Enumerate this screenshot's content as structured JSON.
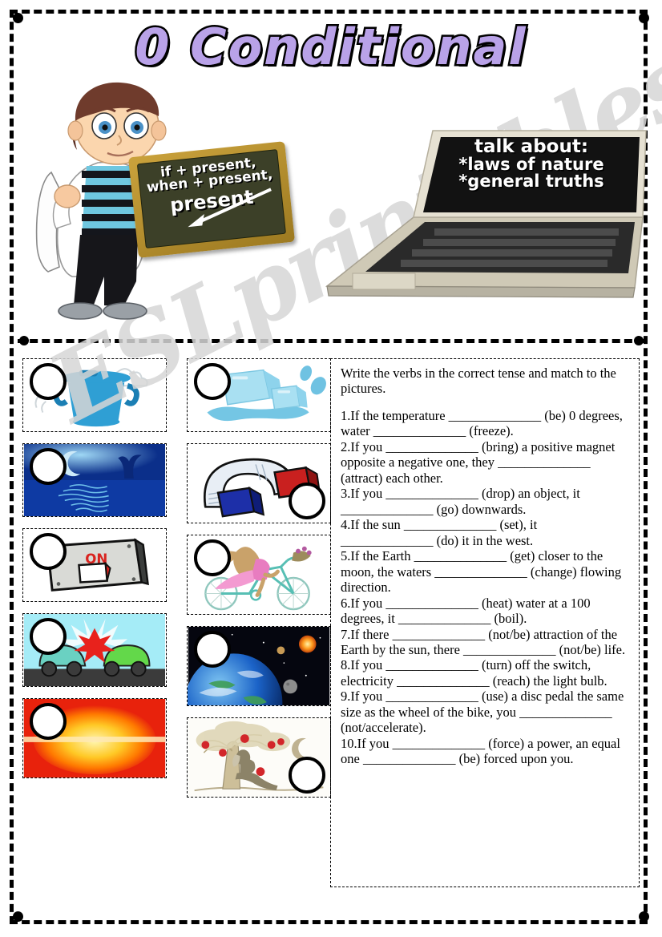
{
  "page": {
    "title": "0 Conditional",
    "watermark": "ESLprintables.com"
  },
  "header": {
    "chalkboard": {
      "line1": "if + present,",
      "line2": "when + present,",
      "line3": "present"
    },
    "laptop_screen": {
      "line1": "talk about:",
      "line2": "*laws of nature",
      "line3": "*general truths"
    }
  },
  "exercise": {
    "instruction": "Write the verbs in the correct tense and match to the pictures.",
    "items": [
      "1.If the temperature ______________ (be) 0 degrees, water ______________ (freeze).",
      "2.If you ______________ (bring) a positive magnet opposite a negative one, they ______________ (attract) each other.",
      "3.If you ______________ (drop) an object, it ______________ (go) downwards.",
      "4.If the sun ______________ (set), it ______________ (do) it in the west.",
      "5.If the Earth ______________ (get) closer to the moon, the waters ______________ (change) flowing direction.",
      "6.If you ______________ (heat) water at a 100 degrees, it ______________ (boil).",
      "7.If there ______________ (not/be) attraction of the Earth by the sun, there ______________ (not/be) life.",
      "8.If you ______________ (turn) off the switch, electricity ______________ (reach) the light bulb.",
      "9.If you ______________ (use) a disc pedal the same size as the wheel of the bike, you ______________ (not/accelerate).",
      "10.If you ______________ (force) a power, an equal one ______________ (be) forced upon you."
    ]
  },
  "pictures": {
    "column1": [
      {
        "id": "boiling-pot",
        "label": "boiling pot with steam",
        "circle": "top-left"
      },
      {
        "id": "moonlit-sea",
        "label": "moonlit sea at night",
        "circle": "top-left"
      },
      {
        "id": "light-switch",
        "label": "light switch marked ON",
        "circle": "top-left",
        "switch_text": "ON"
      },
      {
        "id": "car-crash",
        "label": "two cars colliding",
        "circle": "top-left"
      },
      {
        "id": "sunset",
        "label": "sun setting",
        "circle": "top-left"
      }
    ],
    "column2": [
      {
        "id": "melting-ice",
        "label": "melting ice cubes",
        "circle": "top-left"
      },
      {
        "id": "magnet",
        "label": "horseshoe magnet with red and blue poles",
        "circle": "bottom-right"
      },
      {
        "id": "woman-bicycle",
        "label": "woman riding a bicycle",
        "circle": "top-left"
      },
      {
        "id": "earth-space",
        "label": "Earth seen from space",
        "circle": "top-left"
      },
      {
        "id": "newton-apple-tree",
        "label": "Newton under the apple tree",
        "circle": "bottom-right"
      }
    ]
  },
  "colors": {
    "title_fill": "#b9a2e8",
    "outline": "#000000",
    "watermark": "#d6d6d6",
    "pot_blue": "#2f9fd4",
    "ice_blue": "#8ed3ec",
    "magnet_red": "#c9201f",
    "magnet_blue": "#1d2fa8",
    "switch_red": "#d9231f",
    "sunset_orange": "#ff7a00",
    "night_blue": "#0b2f8a"
  }
}
